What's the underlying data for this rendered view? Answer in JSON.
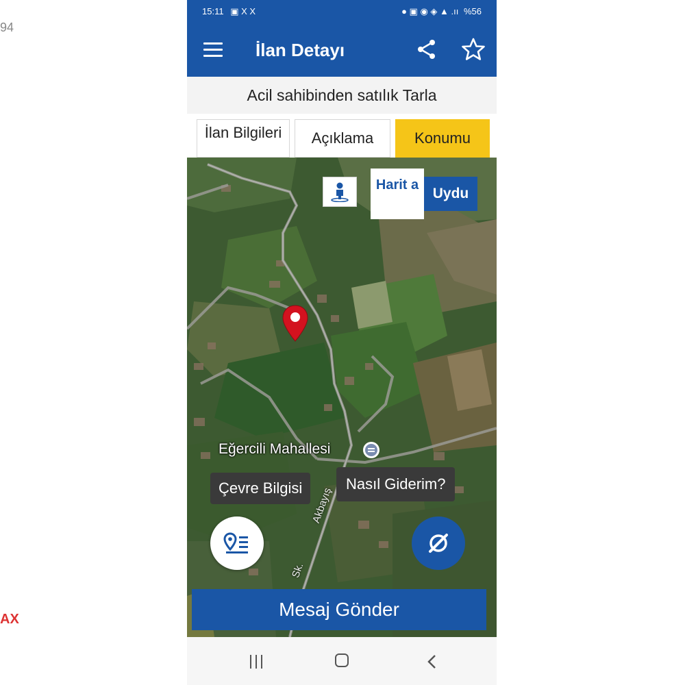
{
  "page_edges": {
    "left_top_text": "94",
    "left_bottom_text": "AX"
  },
  "statusbar": {
    "time": "15:11",
    "left_icons": "▣ X X",
    "right_icons": "● ▣ ◉ ◈ ▲ .ıı",
    "battery": "%56"
  },
  "appbar": {
    "title": "İlan Detayı",
    "icons": [
      "menu-icon",
      "share-icon",
      "star-icon"
    ]
  },
  "listing": {
    "title": "Acil sahibinden satılık Tarla"
  },
  "tabs": [
    {
      "label": "İlan Bilgileri",
      "active": false
    },
    {
      "label": "Açıklama",
      "active": false
    },
    {
      "label": "Konumu",
      "active": true
    }
  ],
  "map": {
    "toggle": {
      "harita_label": "Harit a",
      "uydu_label": "Uydu"
    },
    "place_label": "Eğercili Mahallesi",
    "street_label": "Akbayış",
    "street_label2": "Sk.",
    "cevre_label": "Çevre Bilgisi",
    "nasil_label": "Nasıl Giderim?"
  },
  "send_button": {
    "label": "Mesaj Gönder"
  },
  "colors": {
    "brand": "#1a56a6",
    "active_tab": "#f5c518",
    "pin": "#d3121f"
  }
}
